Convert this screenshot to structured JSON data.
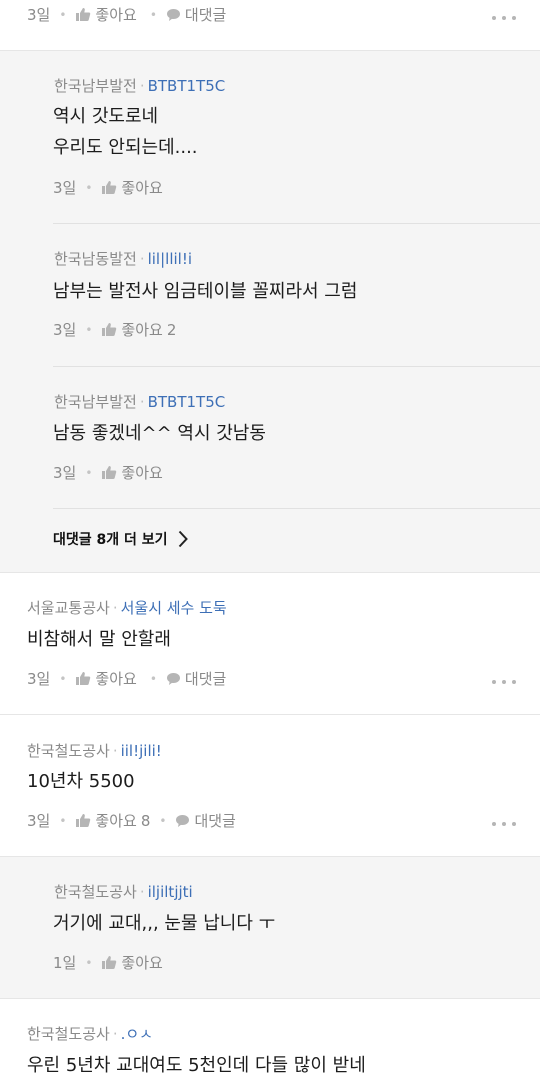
{
  "labels": {
    "like": "좋아요",
    "reply": "대댓글",
    "see_more": "대댓글 8개 더 보기"
  },
  "comments": [
    {
      "time": "3일",
      "like_count": ""
    },
    {
      "author": "한국남부발전",
      "nick": "BTBT1T5C",
      "lines": [
        "역시 갓도로네",
        "우리도 안되는데...."
      ],
      "time": "3일",
      "like_count": ""
    },
    {
      "author": "한국남동발전",
      "nick": "lil|llil!i",
      "lines": [
        "남부는 발전사 임금테이블 꼴찌라서 그럼"
      ],
      "time": "3일",
      "like_count": "2"
    },
    {
      "author": "한국남부발전",
      "nick": "BTBT1T5C",
      "lines": [
        "남동 좋겠네^^ 역시 갓남동"
      ],
      "time": "3일",
      "like_count": ""
    },
    {
      "author": "서울교통공사",
      "nick": "서울시 세수 도둑",
      "lines": [
        "비참해서 말 안할래"
      ],
      "time": "3일",
      "like_count": ""
    },
    {
      "author": "한국철도공사",
      "nick": "iil!jili!",
      "lines": [
        "10년차 5500"
      ],
      "time": "3일",
      "like_count": "8"
    },
    {
      "author": "한국철도공사",
      "nick": "iljiltjjti",
      "lines": [
        "거기에 교대,,, 눈물 납니다 ㅜ"
      ],
      "time": "1일",
      "like_count": ""
    },
    {
      "author": "한국철도공사",
      "nick": ".ㅇㅅ",
      "lines": [
        "우린 5년차 교대여도 5천인데 다들 많이 받네"
      ]
    }
  ]
}
